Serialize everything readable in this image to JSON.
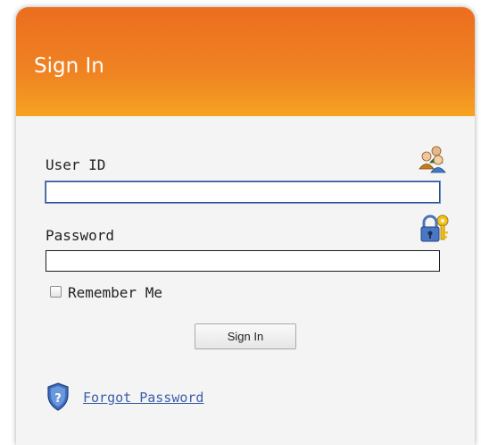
{
  "header": {
    "title": "Sign In"
  },
  "form": {
    "user_id": {
      "label": "User ID",
      "value": "",
      "icon": "users-icon"
    },
    "password": {
      "label": "Password",
      "value": "",
      "icon": "lock-key-icon"
    },
    "remember_me": {
      "label": "Remember Me",
      "checked": false
    },
    "submit_label": "Sign In"
  },
  "footer": {
    "forgot_password_label": "Forgot Password",
    "icon": "help-shield-icon"
  },
  "colors": {
    "header_top": "#ec6d1f",
    "header_bottom": "#f6a322",
    "link": "#3b5fa8",
    "panel_bg": "#f4f4f4"
  }
}
